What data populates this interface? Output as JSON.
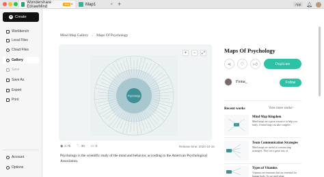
{
  "titlebar": {
    "app_tab": "Wondershare EdrawMind",
    "pro_badge": "Pro",
    "doc_tab": "Map1",
    "app_button": "App"
  },
  "sidebar": {
    "create": "Create",
    "items": [
      {
        "label": "Workbench"
      },
      {
        "label": "Local Files"
      },
      {
        "label": "Cloud Files"
      },
      {
        "label": "Gallery"
      },
      {
        "label": "Save"
      },
      {
        "label": "Save As"
      },
      {
        "label": "Export"
      },
      {
        "label": "Print"
      },
      {
        "label": "Account"
      },
      {
        "label": "Options"
      }
    ]
  },
  "breadcrumb": [
    "Mind Map Gallery",
    "Maps Of Psychology"
  ],
  "preview": {
    "center_label": "Psychology"
  },
  "stats": {
    "views": "2.7k",
    "likes": "30",
    "comments": "0"
  },
  "release": "Release time: 2020-10-16",
  "description": "Psychology is the scientific study of the mind and behavior, according to the American Psychological Association.",
  "detail": {
    "title": "Maps Of Psychology",
    "duplicate": "Duplicate",
    "author": "Fiona_",
    "follow": "Follow"
  },
  "recent": {
    "heading": "Recent works",
    "view_more": "View more works>",
    "works": [
      {
        "title": "Mind Map Kingdom",
        "desc": "Mind maps are a great resource to help you study. A mind map can take complex"
      },
      {
        "title": "Team Communication Strategies",
        "desc": "Mind maps are useful in constructing strategies. They are a great way of"
      },
      {
        "title": "Types of Vitamins",
        "desc": "Vitamins are nutrients that are essential for human body. As we need plant"
      }
    ]
  },
  "colors": {
    "accent": "#2fc1a4",
    "center_node": "#3f8f96"
  }
}
